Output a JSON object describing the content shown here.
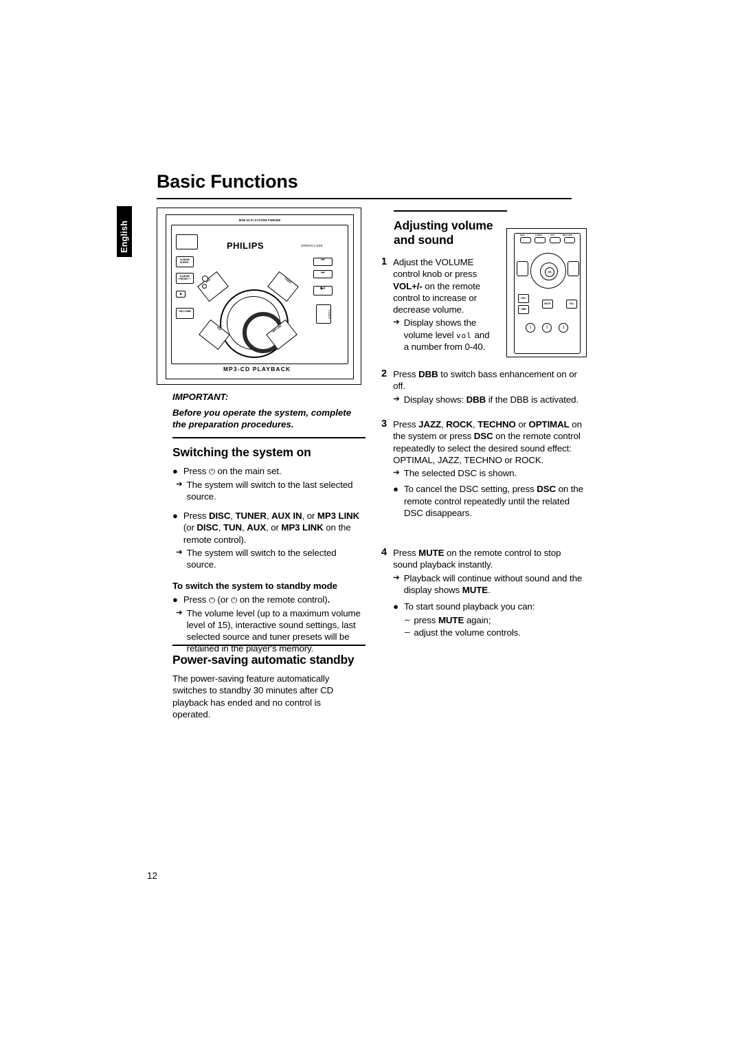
{
  "page": {
    "title": "Basic Functions",
    "side_tab": "English",
    "page_number": "12"
  },
  "figure_main": {
    "name": "hi-fi-system-front-panel",
    "top_label": "MINI HI-FI SYSTEM FWM396",
    "brand": "PHILIPS",
    "open_close": "OPEN/CLOSE",
    "bottom_label": "MP3-CD PLAYBACK",
    "left_buttons": [
      "ALBUM/ SUPER -",
      "ALBUM/ PRESET +",
      "DSC/ DBB"
    ],
    "right_buttons": [
      "PREV",
      "NEXT",
      "PLAY/PAUSE",
      "STOP",
      "TUNER"
    ],
    "dial_flags": [
      "DISC",
      "TUNER",
      "AUX",
      "MP3 LINK"
    ]
  },
  "figure_remote": {
    "name": "remote-control",
    "top_labels": [
      "DISC",
      "TUNER",
      "AUX",
      "MP3 LINK"
    ],
    "keys": [
      "DSC",
      "DBB",
      "MUTE",
      "VOL"
    ],
    "numbers": [
      "1",
      "2",
      "3"
    ]
  },
  "left_column": {
    "important": {
      "heading": "IMPORTANT:",
      "text": "Before you operate the system, complete the preparation procedures."
    },
    "switching": {
      "heading": "Switching the system on",
      "items": [
        {
          "type": "bullet",
          "text_pre": "Press ",
          "glyph": "⏻",
          "text_post": " on the main set."
        },
        {
          "type": "arrow",
          "text": "The system will switch to the last selected source."
        },
        {
          "type": "bullet_rich",
          "segments": [
            {
              "t": "Press ",
              "b": false
            },
            {
              "t": "DISC",
              "b": true
            },
            {
              "t": ", ",
              "b": false
            },
            {
              "t": "TUNER",
              "b": true
            },
            {
              "t": ", ",
              "b": false
            },
            {
              "t": "AUX IN",
              "b": true
            },
            {
              "t": ", or ",
              "b": false
            },
            {
              "t": "MP3 LINK ",
              "b": true
            },
            {
              "t": "(or ",
              "b": false
            },
            {
              "t": "DISC",
              "b": true
            },
            {
              "t": ", ",
              "b": false
            },
            {
              "t": "TUN",
              "b": true
            },
            {
              "t": ", ",
              "b": false
            },
            {
              "t": "AUX",
              "b": true
            },
            {
              "t": ", or ",
              "b": false
            },
            {
              "t": "MP3 LINK",
              "b": true
            },
            {
              "t": " on the remote control).",
              "b": false
            }
          ]
        },
        {
          "type": "arrow",
          "text": "The system will switch to the selected source."
        }
      ],
      "standby_heading": "To switch the system to standby mode",
      "standby_items": [
        {
          "type": "bullet",
          "text": "Press ⏻ (or ⏻ on the remote control)."
        },
        {
          "type": "arrow",
          "text": "The volume level (up to a maximum volume level of 15), interactive sound settings, last selected source and tuner presets will be retained in the player's memory."
        }
      ]
    },
    "power_saving": {
      "heading_bold": "Power-saving",
      "heading_rest": " automatic standby",
      "text": "The power-saving feature automatically switches to standby 30 minutes after CD playback has ended and no control is operated."
    }
  },
  "right_column": {
    "heading_line1": "Adjusting volume",
    "heading_line2": "and sound",
    "steps": [
      {
        "num": "1",
        "segments": [
          {
            "t": "Adjust the VOLUME control knob or press ",
            "b": false
          },
          {
            "t": "VOL+/-",
            "b": true
          },
          {
            "t": " on the remote control to increase or decrease volume.",
            "b": false
          }
        ],
        "arrows": [
          {
            "segments": [
              {
                "t": "Display shows the volume level ",
                "b": false
              },
              {
                "t": "vol",
                "b": false,
                "mono": true
              },
              {
                "t": " and a number from 0-40.",
                "b": false
              }
            ]
          }
        ]
      },
      {
        "num": "2",
        "segments": [
          {
            "t": "Press ",
            "b": false
          },
          {
            "t": "DBB",
            "b": true
          },
          {
            "t": " to switch bass enhancement on or off.",
            "b": false
          }
        ],
        "arrows": [
          {
            "segments": [
              {
                "t": "Display shows: ",
                "b": false
              },
              {
                "t": "DBB",
                "b": true
              },
              {
                "t": " if the DBB is activated.",
                "b": false
              }
            ]
          }
        ]
      },
      {
        "num": "3",
        "segments": [
          {
            "t": "Press ",
            "b": false
          },
          {
            "t": "JAZZ",
            "b": true
          },
          {
            "t": ", ",
            "b": false
          },
          {
            "t": "ROCK",
            "b": true
          },
          {
            "t": ", ",
            "b": false
          },
          {
            "t": "TECHNO",
            "b": true
          },
          {
            "t": " or ",
            "b": false
          },
          {
            "t": "OPTIMAL",
            "b": true
          },
          {
            "t": " on the system or press ",
            "b": false
          },
          {
            "t": "DSC",
            "b": true
          },
          {
            "t": " on the remote control repeatedly to select the desired sound effect: OPTIMAL, JAZZ, TECHNO or ROCK.",
            "b": false
          }
        ],
        "arrows": [
          {
            "segments": [
              {
                "t": "The selected DSC is shown.",
                "b": false
              }
            ]
          }
        ],
        "bullets": [
          {
            "segments": [
              {
                "t": "To cancel the DSC setting, press ",
                "b": false
              },
              {
                "t": "DSC",
                "b": true
              },
              {
                "t": " on the remote control repeatedly until the related DSC disappears.",
                "b": false
              }
            ]
          }
        ]
      },
      {
        "num": "4",
        "segments": [
          {
            "t": "Press ",
            "b": false
          },
          {
            "t": "MUTE",
            "b": true
          },
          {
            "t": " on the remote control to stop sound playback instantly.",
            "b": false
          }
        ],
        "arrows": [
          {
            "segments": [
              {
                "t": "Playback will continue without sound and the display shows ",
                "b": false
              },
              {
                "t": "MUTE",
                "b": true
              },
              {
                "t": ".",
                "b": false
              }
            ]
          }
        ],
        "bullets": [
          {
            "segments": [
              {
                "t": "To start sound playback you can:",
                "b": false
              }
            ]
          }
        ],
        "dashes": [
          {
            "segments": [
              {
                "t": "press ",
                "b": false
              },
              {
                "t": "MUTE",
                "b": true
              },
              {
                "t": " again;",
                "b": false
              }
            ]
          },
          {
            "segments": [
              {
                "t": "adjust the volume controls.",
                "b": false
              }
            ]
          }
        ]
      }
    ]
  }
}
